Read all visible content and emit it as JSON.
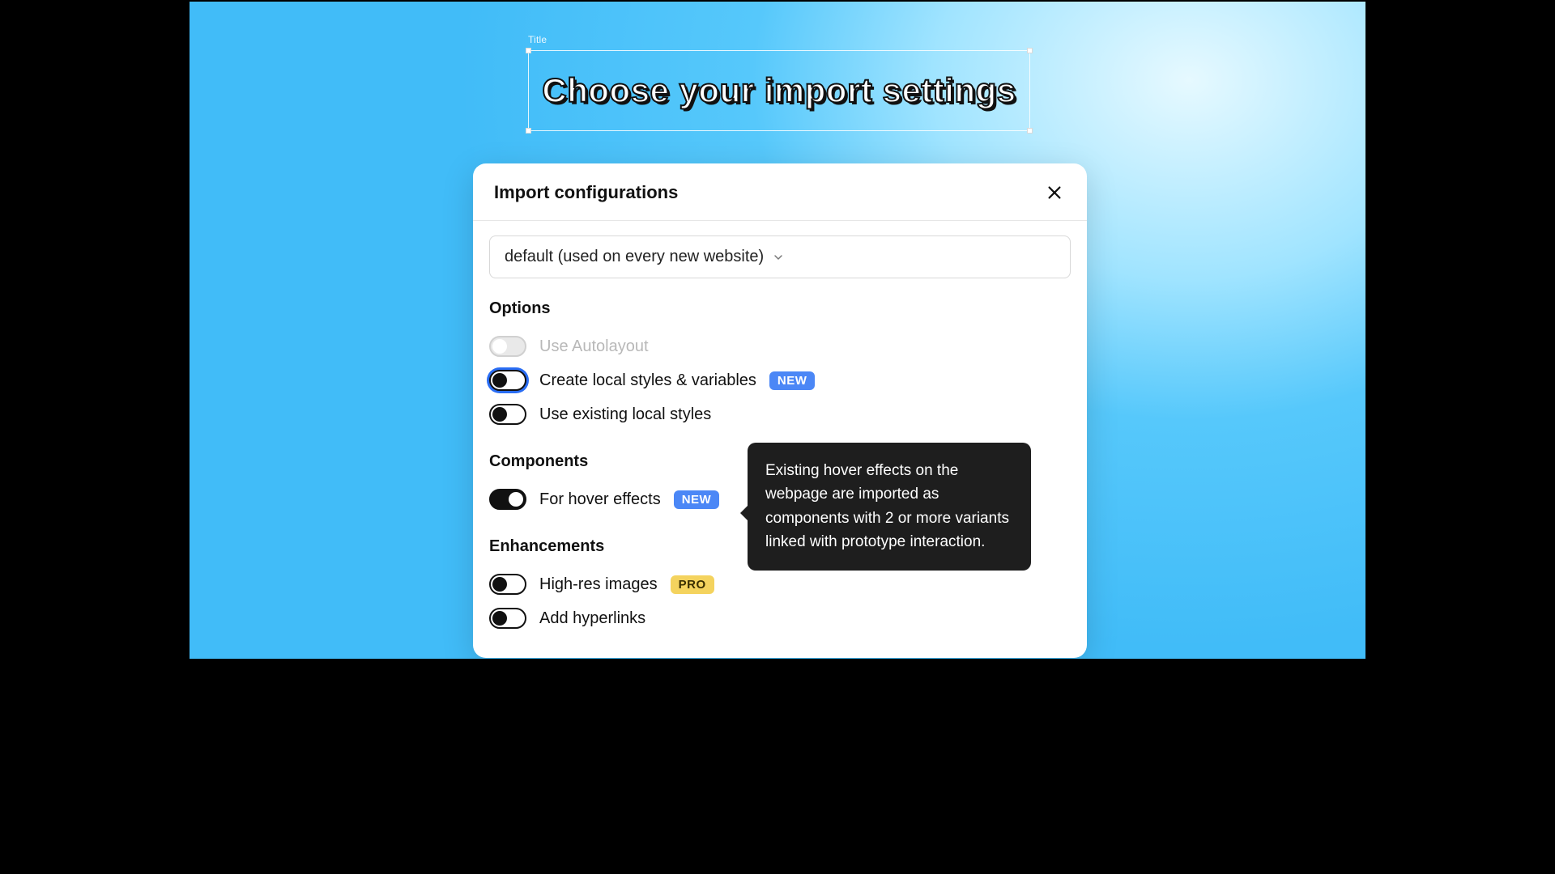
{
  "canvas": {
    "frame_label": "Title",
    "title_text": "Choose your import settings"
  },
  "modal": {
    "title": "Import configurations",
    "select_value": "default (used on every new website)",
    "sections": {
      "options": {
        "heading": "Options",
        "items": [
          {
            "label": "Use Autolayout",
            "badge": null
          },
          {
            "label": "Create local styles & variables",
            "badge": "NEW"
          },
          {
            "label": "Use existing local styles",
            "badge": null
          }
        ]
      },
      "components": {
        "heading": "Components",
        "items": [
          {
            "label": "For hover effects",
            "badge": "NEW"
          }
        ]
      },
      "enhancements": {
        "heading": "Enhancements",
        "items": [
          {
            "label": "High-res images",
            "badge": "PRO"
          },
          {
            "label": "Add hyperlinks",
            "badge": null
          }
        ]
      }
    }
  },
  "tooltip": {
    "text": "Existing hover effects on the webpage are imported as components with 2 or more variants linked with prototype interaction."
  },
  "badges": {
    "new": "NEW",
    "pro": "PRO"
  }
}
